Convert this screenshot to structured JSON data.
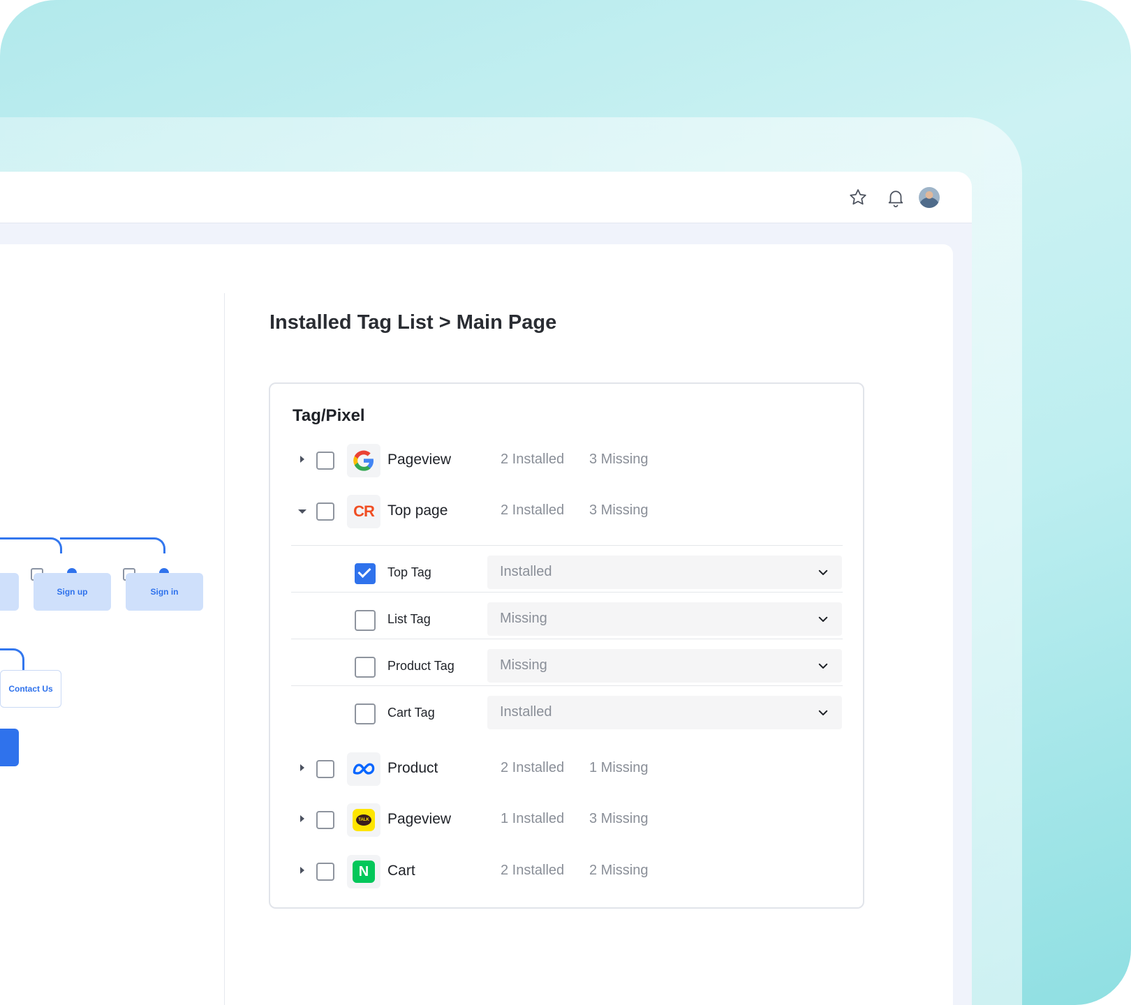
{
  "header": {
    "favorite_icon": "star-icon",
    "notification_icon": "bell-icon",
    "avatar": "user-avatar"
  },
  "flow": {
    "nodes": {
      "sign_up": "Sign up",
      "sign_in": "Sign in",
      "contact_us": "Contact Us"
    }
  },
  "page": {
    "title": "Installed Tag List > Main Page"
  },
  "card": {
    "title": "Tag/Pixel",
    "rows": [
      {
        "name": "Pageview",
        "installed": "2 Installed",
        "missing": "3 Missing",
        "logo": "google-logo",
        "expanded": false
      },
      {
        "name": "Top page",
        "installed": "2 Installed",
        "missing": "3 Missing",
        "logo": "criteo-logo",
        "expanded": true
      },
      {
        "name": "Product",
        "installed": "2 Installed",
        "missing": "1 Missing",
        "logo": "meta-logo",
        "expanded": false
      },
      {
        "name": "Pageview",
        "installed": "1 Installed",
        "missing": "3 Missing",
        "logo": "kakao-talk-logo",
        "expanded": false
      },
      {
        "name": "Cart",
        "installed": "2 Installed",
        "missing": "2 Missing",
        "logo": "naver-logo",
        "expanded": false
      }
    ],
    "sub_rows": [
      {
        "name": "Top Tag",
        "status": "Installed",
        "checked": true
      },
      {
        "name": "List Tag",
        "status": "Missing",
        "checked": false
      },
      {
        "name": "Product Tag",
        "status": "Missing",
        "checked": false
      },
      {
        "name": "Cart Tag",
        "status": "Installed",
        "checked": false
      }
    ]
  },
  "logos": {
    "criteo_text": "CR",
    "kakao_text": "TALK",
    "naver_text": "N"
  },
  "colors": {
    "accent": "#2f72ec",
    "muted_text": "#8a8f98",
    "google_blue": "#4285F4",
    "google_red": "#EA4335",
    "google_yellow": "#FBBC05",
    "google_green": "#34A853",
    "criteo_orange": "#f04e23",
    "kakao_yellow": "#fee500",
    "naver_green": "#03c75a"
  }
}
